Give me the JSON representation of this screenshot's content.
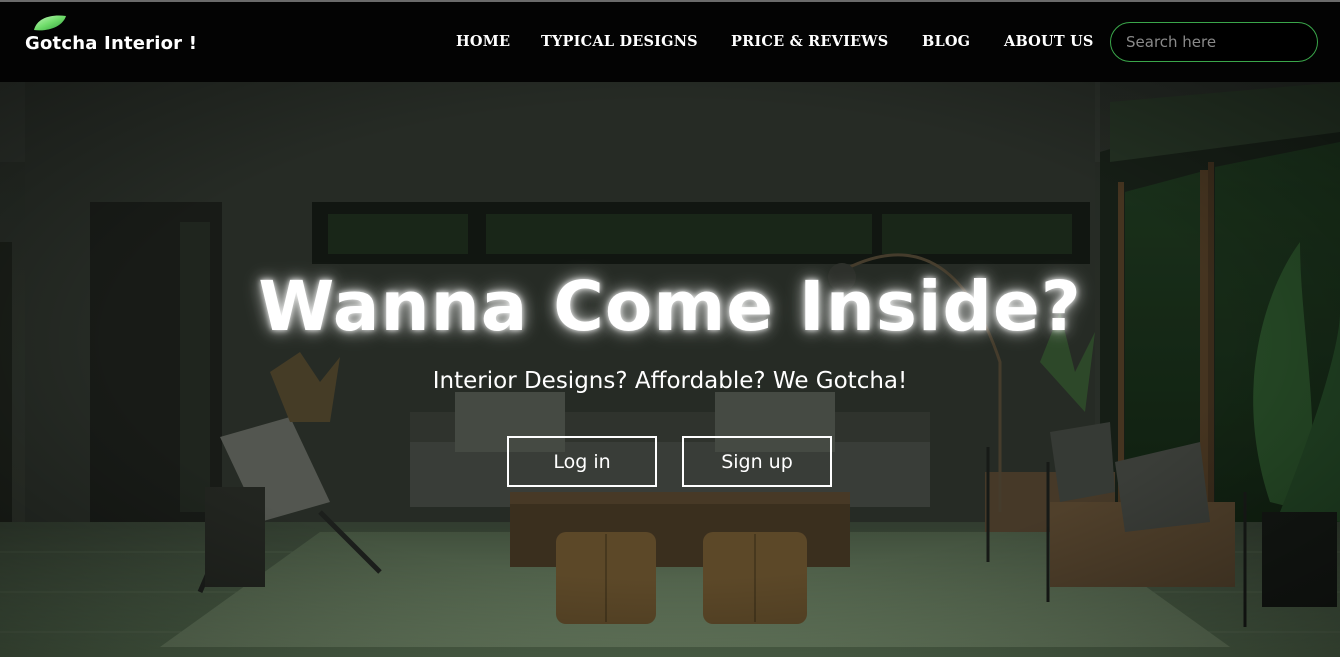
{
  "navbar": {
    "brand": "Gotcha Interior !",
    "links": [
      "HOME",
      "TYPICAL DESIGNS",
      "PRICE & REVIEWS",
      "BLOG",
      "ABOUT US"
    ],
    "search_placeholder": "Search here"
  },
  "hero": {
    "title": "Wanna Come Inside?",
    "subtitle": "Interior Designs? Affordable? We Gotcha!",
    "login_label": "Log in",
    "signup_label": "Sign up"
  },
  "colors": {
    "navbar_bg": "#030303",
    "accent_green": "#3aa64a",
    "leaf_green": "#7ee07e",
    "text": "#ffffff"
  },
  "icons": {
    "brand_logo": "leaf-icon"
  }
}
